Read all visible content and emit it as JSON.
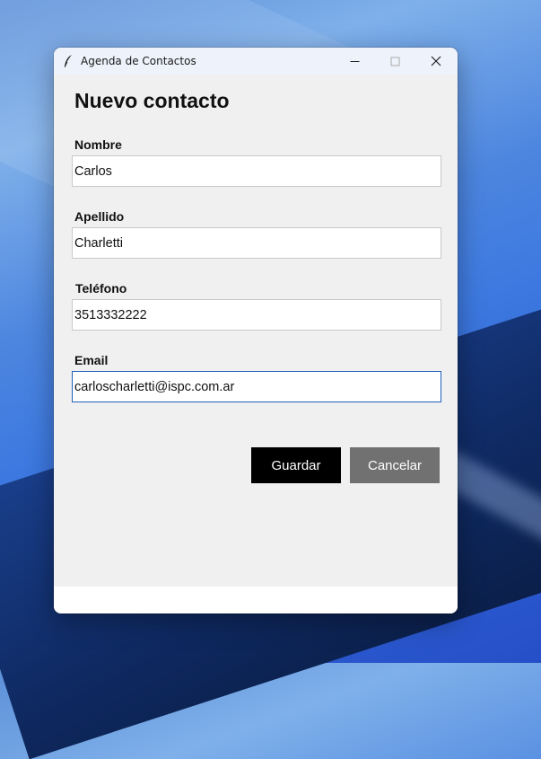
{
  "window": {
    "title": "Agenda de Contactos",
    "controls": {
      "minimize_icon": "minimize-icon",
      "maximize_icon": "maximize-icon",
      "close_icon": "close-icon"
    }
  },
  "form": {
    "heading": "Nuevo contacto",
    "fields": [
      {
        "label": "Nombre",
        "value": "Carlos"
      },
      {
        "label": "Apellido",
        "value": "Charletti"
      },
      {
        "label": "Teléfono",
        "value": "3513332222"
      },
      {
        "label": "Email",
        "value": "carloscharletti@ispc.com.ar"
      }
    ],
    "buttons": {
      "save": "Guardar",
      "cancel": "Cancelar"
    }
  },
  "colors": {
    "save_button": "#000000",
    "cancel_button": "#717171",
    "focus_border": "#1f5fb8",
    "window_bg": "#f0f0f0"
  }
}
